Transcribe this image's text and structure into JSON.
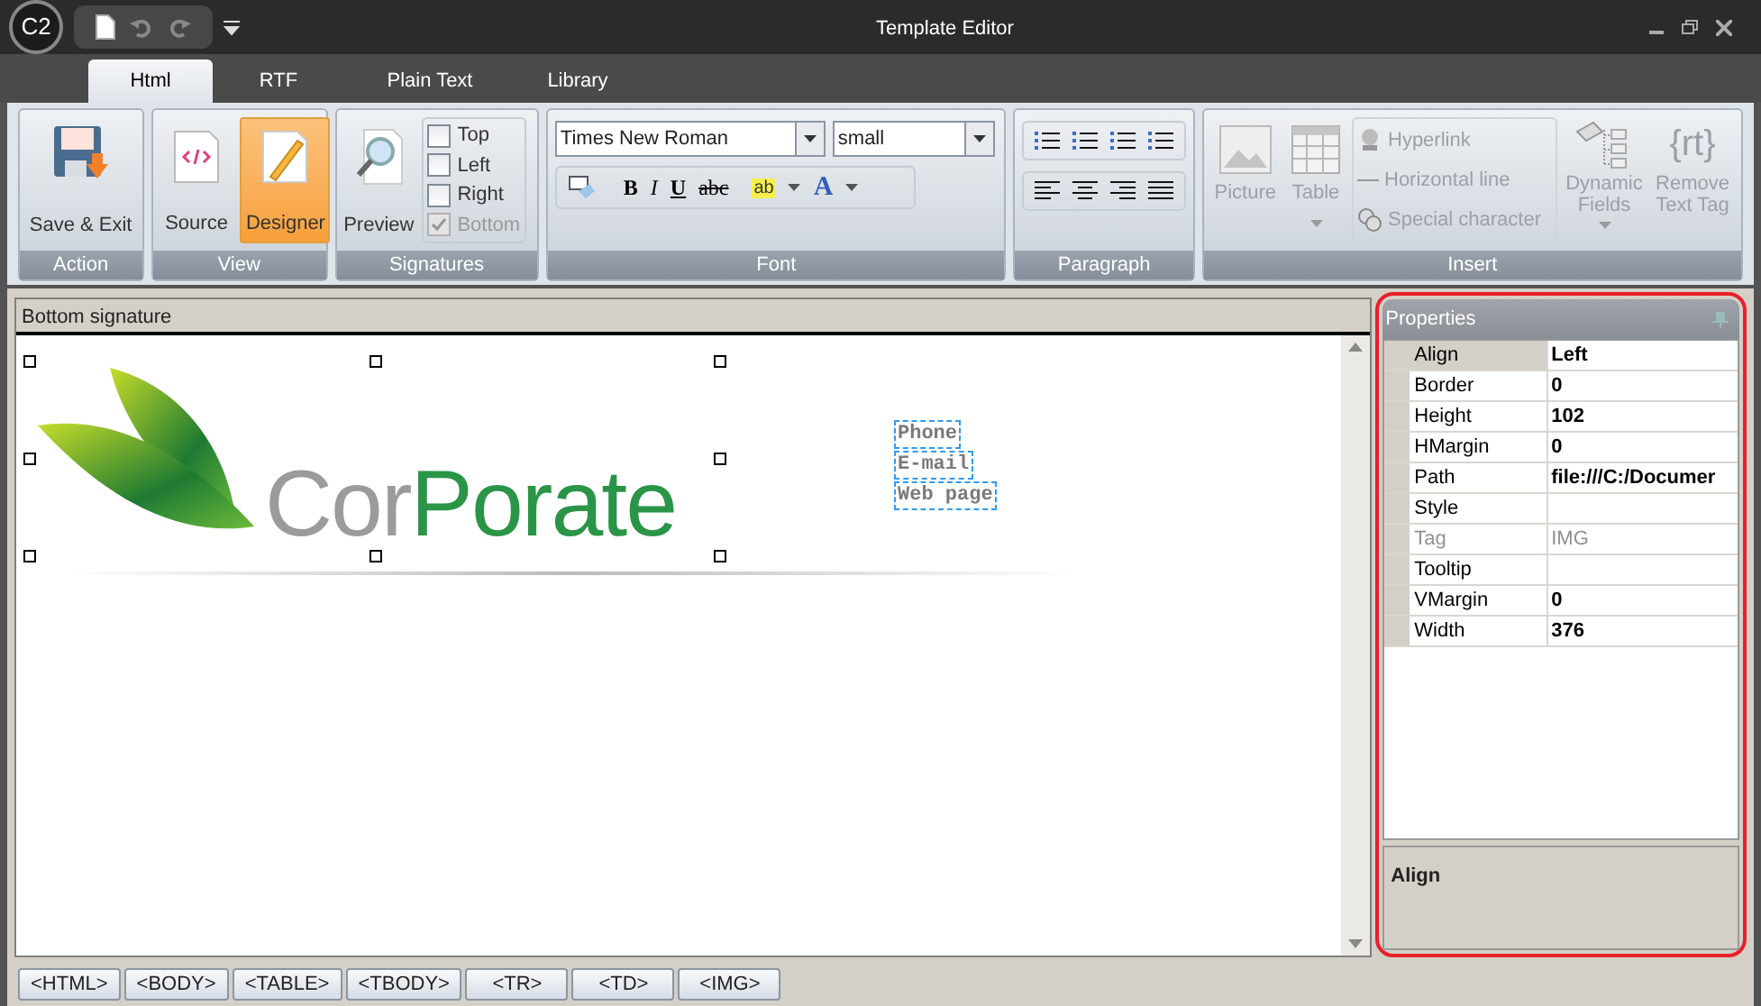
{
  "window": {
    "title": "Template Editor",
    "logo": "C2"
  },
  "tabs": [
    {
      "label": "Html",
      "selected": true
    },
    {
      "label": "RTF",
      "selected": false
    },
    {
      "label": "Plain Text",
      "selected": false
    },
    {
      "label": "Library",
      "selected": false
    }
  ],
  "ribbon": {
    "action": {
      "label": "Action",
      "button": "Save & Exit"
    },
    "view": {
      "label": "View",
      "buttons": [
        {
          "label": "Source",
          "selected": false
        },
        {
          "label": "Designer",
          "selected": true
        }
      ]
    },
    "signatures": {
      "label": "Signatures",
      "button": "Preview",
      "checkboxes": [
        {
          "label": "Top",
          "checked": false,
          "disabled": false
        },
        {
          "label": "Left",
          "checked": false,
          "disabled": false
        },
        {
          "label": "Right",
          "checked": false,
          "disabled": false
        },
        {
          "label": "Bottom",
          "checked": true,
          "disabled": true
        }
      ]
    },
    "font": {
      "label": "Font",
      "font_name": "Times New Roman",
      "font_size": "small",
      "format_buttons": [
        "B",
        "I",
        "U",
        "abc"
      ],
      "color_letter": "A",
      "highlight_letters": "ab"
    },
    "paragraph": {
      "label": "Paragraph"
    },
    "insert": {
      "label": "Insert",
      "disabled": true,
      "picture": "Picture",
      "table": "Table",
      "links": [
        "Hyperlink",
        "Horizontal line",
        "Special character"
      ],
      "dynamic_fields": "Dynamic Fields",
      "remove_tag": "Remove Text Tag",
      "tag_glyph": "{rt}"
    }
  },
  "editor": {
    "title": "Bottom signature",
    "logo": {
      "part_1": "Cor",
      "part_2": "Porate"
    },
    "fields": [
      "Phone",
      "E-mail",
      "Web page"
    ]
  },
  "properties": {
    "title": "Properties",
    "rows": [
      {
        "name": "Align",
        "value": "Left",
        "selected": true,
        "disabled": false
      },
      {
        "name": "Border",
        "value": "0",
        "selected": false,
        "disabled": false
      },
      {
        "name": "Height",
        "value": "102",
        "selected": false,
        "disabled": false
      },
      {
        "name": "HMargin",
        "value": "0",
        "selected": false,
        "disabled": false
      },
      {
        "name": "Path",
        "value": "file:///C:/Documer",
        "selected": false,
        "disabled": false
      },
      {
        "name": "Style",
        "value": "",
        "selected": false,
        "disabled": false
      },
      {
        "name": "Tag",
        "value": "IMG",
        "selected": false,
        "disabled": true
      },
      {
        "name": "Tooltip",
        "value": "",
        "selected": false,
        "disabled": false
      },
      {
        "name": "VMargin",
        "value": "0",
        "selected": false,
        "disabled": false
      },
      {
        "name": "Width",
        "value": "376",
        "selected": false,
        "disabled": false
      }
    ],
    "description": "Align"
  },
  "breadcrumb": [
    "<HTML>",
    "<BODY>",
    "<TABLE>",
    "<TBODY>",
    "<TR>",
    "<TD>",
    "<IMG>"
  ]
}
